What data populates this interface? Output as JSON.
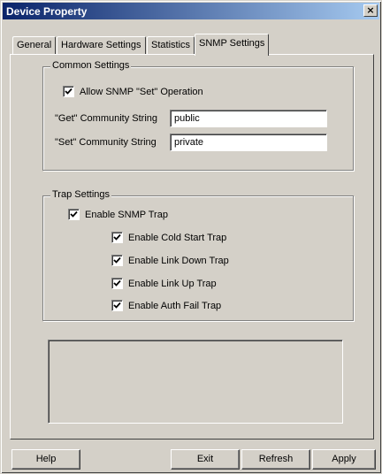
{
  "window": {
    "title": "Device Property",
    "close_label": "×"
  },
  "tabs": [
    {
      "label": "General",
      "active": false
    },
    {
      "label": "Hardware Settings",
      "active": false
    },
    {
      "label": "Statistics",
      "active": false
    },
    {
      "label": "SNMP Settings",
      "active": true
    }
  ],
  "common_settings": {
    "legend": "Common Settings",
    "allow_set": {
      "label": "Allow SNMP \"Set\" Operation",
      "checked": true
    },
    "get_label": "\"Get\" Community String",
    "get_value": "public",
    "set_label": "\"Set\" Community String",
    "set_value": "private"
  },
  "trap_settings": {
    "legend": "Trap Settings",
    "enable_trap": {
      "label": "Enable SNMP Trap",
      "checked": true
    },
    "traps": [
      {
        "label": "Enable Cold Start Trap",
        "checked": true
      },
      {
        "label": "Enable Link Down Trap",
        "checked": true
      },
      {
        "label": "Enable Link Up Trap",
        "checked": true
      },
      {
        "label": "Enable Auth Fail Trap",
        "checked": true
      }
    ]
  },
  "buttons": {
    "help": "Help",
    "exit": "Exit",
    "refresh": "Refresh",
    "apply": "Apply"
  },
  "colors": {
    "face": "#d4d0c8",
    "title_start": "#0a246a",
    "title_end": "#a6caf0"
  }
}
